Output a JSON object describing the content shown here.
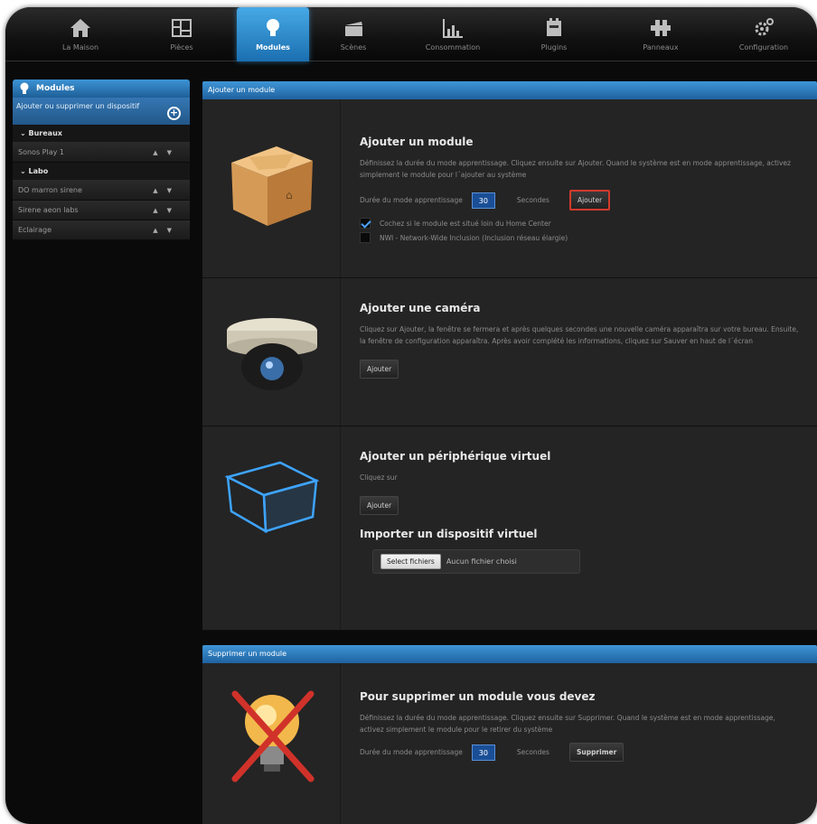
{
  "nav": [
    {
      "label": "La Maison",
      "icon": "house-icon"
    },
    {
      "label": "Pièces",
      "icon": "rooms-icon"
    },
    {
      "label": "Modules",
      "icon": "lightbulb-icon",
      "active": true
    },
    {
      "label": "Scènes",
      "icon": "clapperboard-icon"
    },
    {
      "label": "Consommation",
      "icon": "bar-chart-icon"
    },
    {
      "label": "Plugins",
      "icon": "plugin-icon"
    },
    {
      "label": "Panneaux",
      "icon": "panels-icon"
    },
    {
      "label": "Configuration",
      "icon": "gears-icon"
    }
  ],
  "sidebar": {
    "title": "Modules",
    "add_label": "Ajouter ou supprimer un dispositif",
    "groups": [
      {
        "name": "Bureaux",
        "items": [
          "Sonos Play 1"
        ]
      },
      {
        "name": "Labo",
        "items": [
          "DO marron sirene",
          "Sirene aeon labs",
          "Eclairage"
        ]
      }
    ]
  },
  "add_panel": {
    "header": "Ajouter un module",
    "module": {
      "title": "Ajouter un module",
      "desc": "Définissez la durée du mode apprentissage. Cliquez ensuite sur Ajouter. Quand le système est en mode apprentissage, activez simplement le module pour l´ajouter au système",
      "duration_label": "Durée du mode apprentissage",
      "duration_value": "30",
      "seconds_label": "Secondes",
      "add_button": "Ajouter",
      "checkbox1": "Cochez si le module est situé loin du Home Center",
      "checkbox1_checked": true,
      "checkbox2": "NWI - Network-Wide Inclusion (Inclusion réseau élargie)",
      "checkbox2_checked": false
    },
    "camera": {
      "title": "Ajouter une caméra",
      "desc": "Cliquez sur Ajouter, la fenêtre se fermera et après quelques secondes une nouvelle caméra apparaîtra sur votre bureau. Ensuite, la fenêtre de configuration apparaîtra. Après avoir complété les informations, cliquez sur Sauver en haut de l´écran",
      "add_button": "Ajouter"
    },
    "virtual": {
      "title": "Ajouter un périphérique virtuel",
      "desc": "Cliquez sur",
      "add_button": "Ajouter",
      "import_title": "Importer un dispositif virtuel",
      "file_button": "Select fichiers",
      "file_status": "Aucun fichier choisi"
    }
  },
  "delete_panel": {
    "header": "Supprimer un module",
    "title": "Pour supprimer un module vous devez",
    "desc": "Définissez la durée du mode apprentissage. Cliquez ensuite sur Supprimer. Quand le système est en mode apprentissage, activez simplement le module pour le retirer du système",
    "duration_label": "Durée du mode apprentissage",
    "duration_value": "30",
    "seconds_label": "Secondes",
    "delete_button": "Supprimer"
  },
  "colors": {
    "accent_blue": "#2f7fc4",
    "highlight_red": "#d23a2c",
    "panel_bg": "#242424"
  }
}
